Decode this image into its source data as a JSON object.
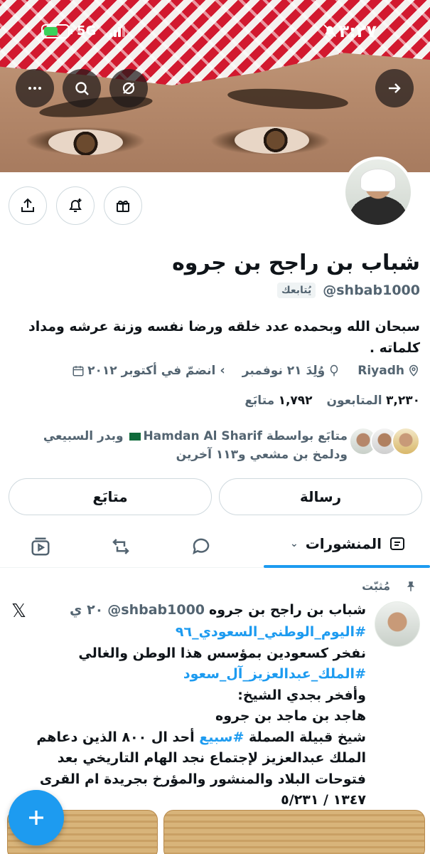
{
  "status_bar": {
    "time": "٣:٢٧",
    "network": "5G",
    "battery_level": 0.6
  },
  "profile": {
    "name": "شباب بن راجح بن جروه",
    "handle": "@shbab1000",
    "follows_you": "يُتابعك",
    "bio": "سبحان الله وبحمده عدد خلقه ورضا نفسه وزنة عرشه ومداد كلماته .",
    "location": "Riyadh",
    "born": "وُلِدَ ٢١ نوفمبر",
    "joined": "انضمّ في أكتوبر ٢٠١٢",
    "following_count": "١,٧٩٢",
    "following_label": "متابَع",
    "followers_count": "٣,٢٣٠",
    "followers_label": "المتابعون",
    "followed_by_prefix": "متابَع بواسطة",
    "followed_by_name1": "Hamdan Al Sharif",
    "followed_by_rest": "وبدر السبيعي ودلمخ بن مشعي و١١٣ آخرين"
  },
  "actions": {
    "message": "رسالة",
    "follow": "متابَع"
  },
  "tabs": {
    "posts": "المنشورات"
  },
  "post": {
    "pinned_label": "مُثبّت",
    "author_name": "شباب بن راجح بن جروه",
    "author_handle": "@shbab1000",
    "time": "٢٠ ي",
    "hashtag1": "#اليوم_الوطني_السعودي_٩٦",
    "line2": "نفخر كسعودين بمؤسس هذا الوطن والغالي",
    "hashtag2": "#الملك_عبدالعزيز_آل_سعود",
    "line4": "وأفخر بجدي الشيخ:",
    "line5": "هاجد بن ماجد بن جروه",
    "line6_a": "شيخ قبيلة الصملة",
    "hashtag3": "#سبيع",
    "line6_b": "أحد ال ٨٠٠ الذين دعاهم الملك عبدالعزيز لإجتماع نجد الهام التاريخي بعد فتوحات البلاد والمنشور والمؤرخ بجريدة ام القرى",
    "line7": "١٣٤٧ / ٥/٢٣١"
  },
  "colors": {
    "accent": "#1d9bf0",
    "secondary_text": "#536471",
    "border": "#cfd9de"
  }
}
